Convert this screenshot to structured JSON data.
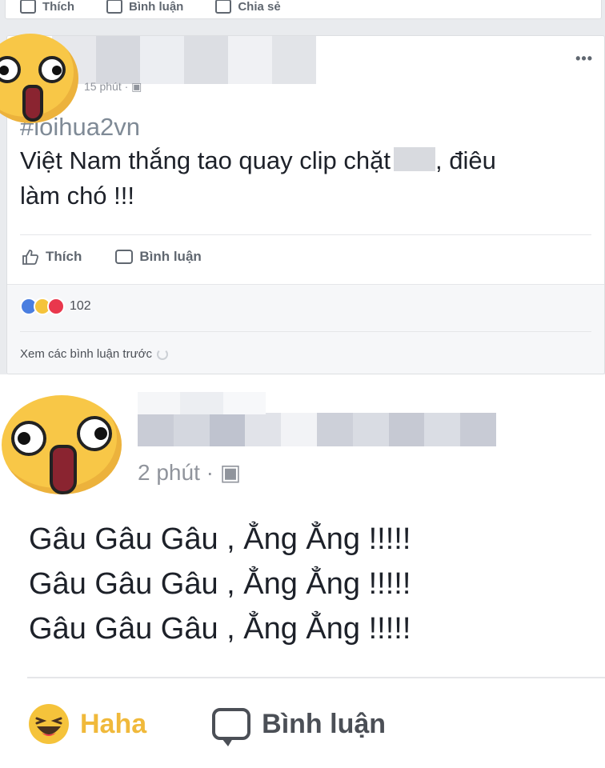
{
  "top_card": {
    "actions": [
      "Thích",
      "Bình luận",
      "Chia sẻ"
    ]
  },
  "post1": {
    "time": "15 phút ·",
    "hashtag": "#loihua2vn",
    "text_line1": "Việt Nam thắng tao quay clip chặt",
    "text_line1_end": ", điêu",
    "text_line2": "làm chó !!!",
    "actions": {
      "like": "Thích",
      "comment": "Bình luận"
    },
    "reaction_count": "102",
    "view_previous": "Xem các bình luận trước"
  },
  "post2": {
    "time": "2 phút ·",
    "lines": [
      "Gâu Gâu Gâu , Ẳng Ẳng !!!!!",
      "Gâu Gâu Gâu , Ẳng Ẳng !!!!!",
      "Gâu Gâu Gâu , Ẳng Ẳng !!!!!"
    ],
    "actions": {
      "haha": "Haha",
      "comment": "Bình luận"
    }
  },
  "colors": {
    "haha": "#f0b93b",
    "like": "#4a7ee0",
    "love": "#e9374d",
    "feed_bg": "#e9ebee"
  }
}
